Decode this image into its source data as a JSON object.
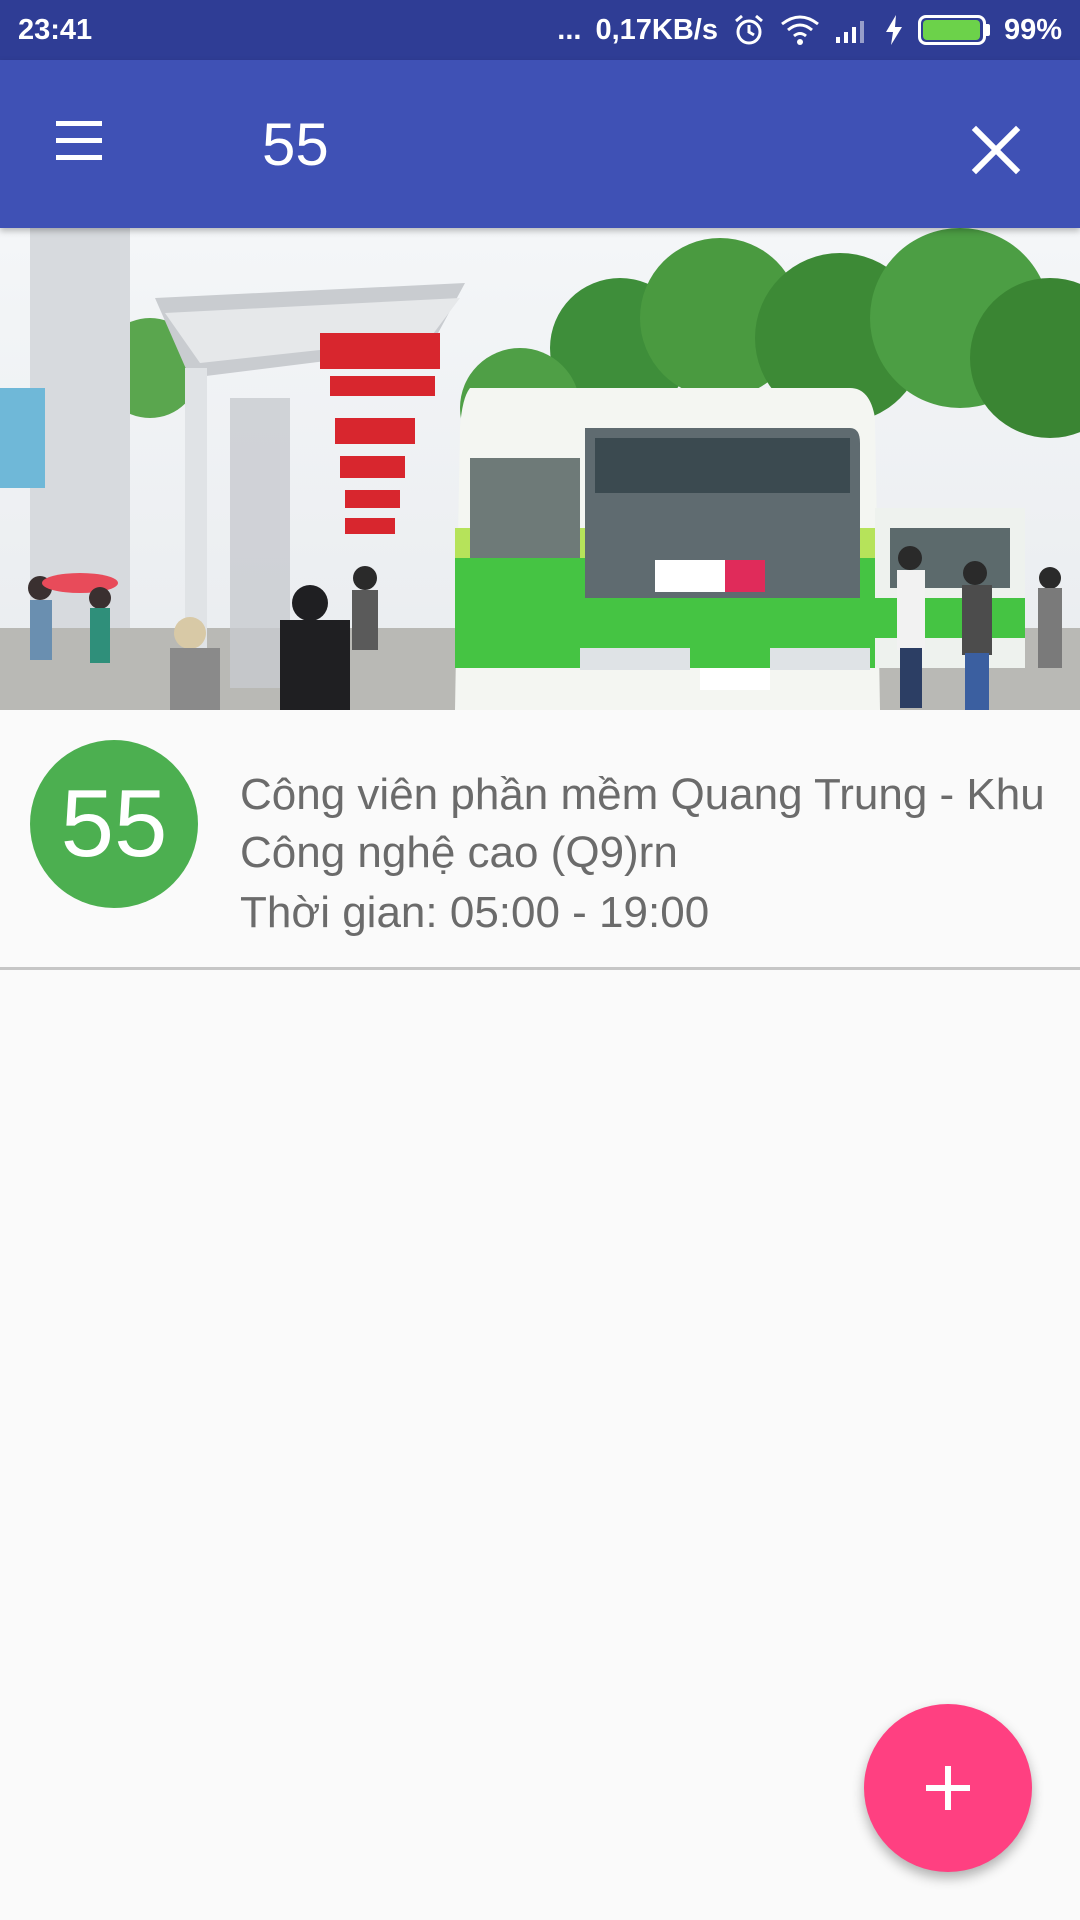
{
  "status_bar": {
    "time": "23:41",
    "dots": "...",
    "network_speed": "0,17KB/s",
    "battery_percent": "99%",
    "battery_level": 0.99,
    "icons": [
      "alarm-icon",
      "wifi-icon",
      "signal-icon",
      "charging-icon",
      "battery-icon"
    ]
  },
  "toolbar": {
    "search_value": "55",
    "menu_icon": "hamburger-menu-icon",
    "close_icon": "close-icon"
  },
  "route": {
    "number": "55",
    "name_line1": "Công viên phần mềm Quang Trung - Khu",
    "name_line2": "Công nghệ cao (Q9)rn",
    "time_label": "Thời gian: ",
    "time_value": "05:00 - 19:00",
    "badge_color": "#4caf50"
  },
  "fab": {
    "icon": "plus-icon",
    "label": "+",
    "color": "#ff4081"
  },
  "colors": {
    "status_bar": "#2f3d95",
    "app_bar": "#3f51b5",
    "background": "#fafafa"
  }
}
